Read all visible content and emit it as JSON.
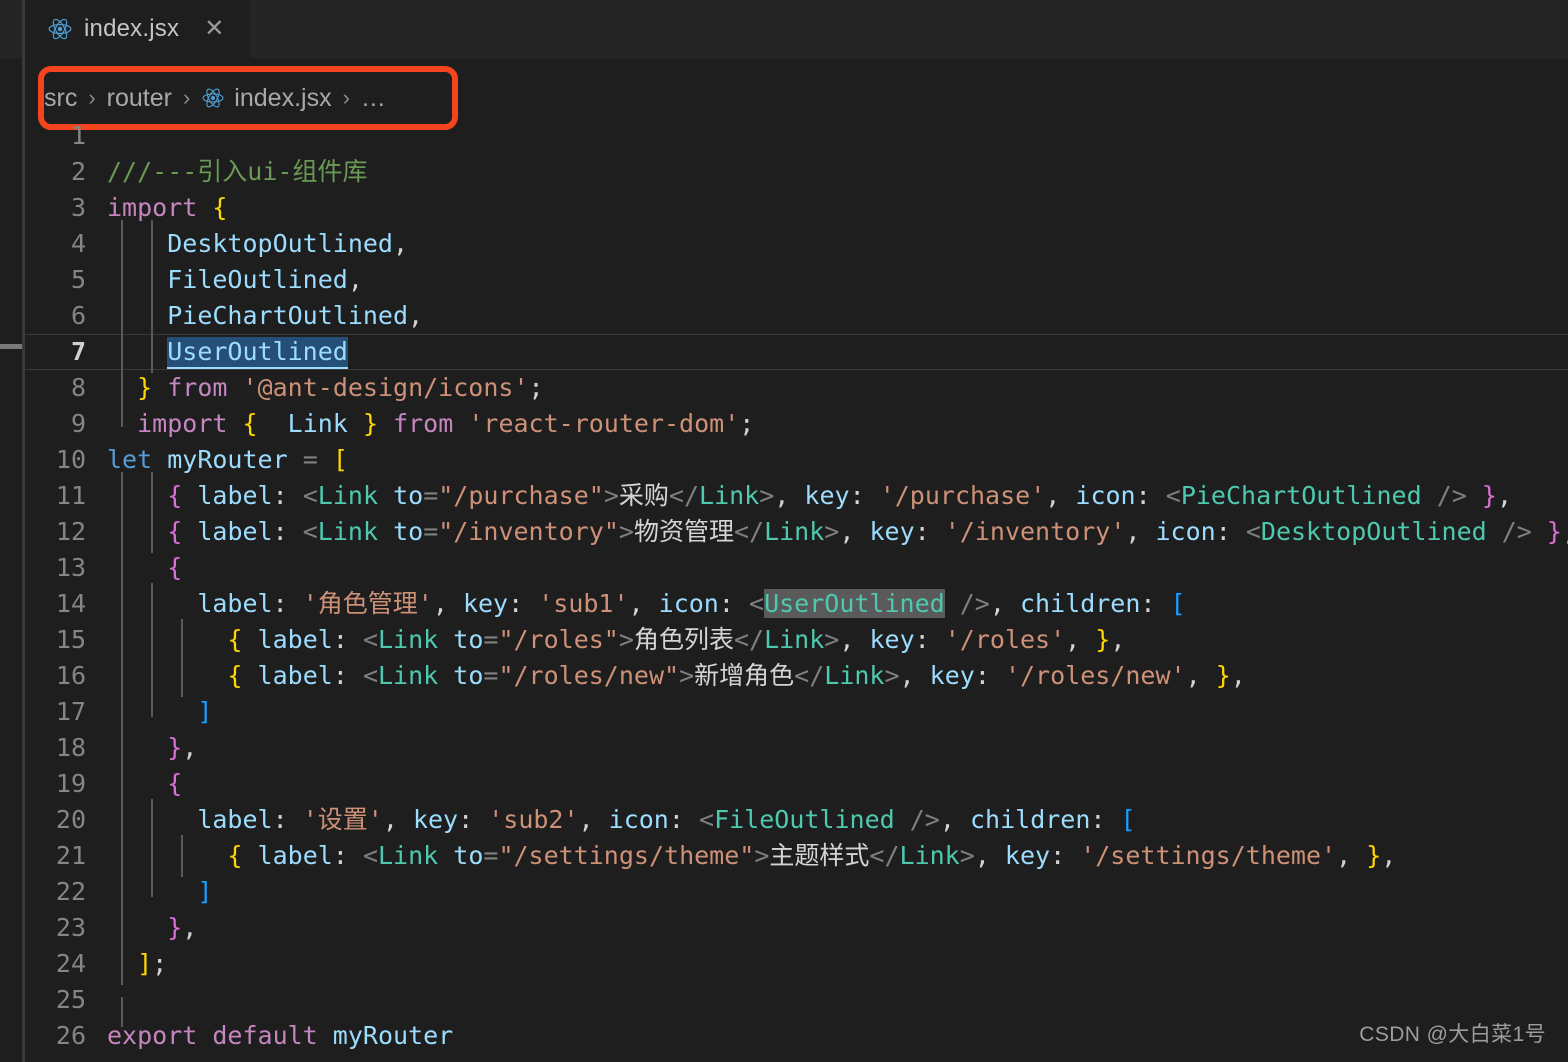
{
  "window": {
    "background": "#1e1e1e",
    "tabbar_background": "#252526"
  },
  "tab": {
    "label": "index.jsx",
    "icon": "react-icon",
    "close_icon": "✕",
    "close_label": "Close"
  },
  "breadcrumb": {
    "separator": "›",
    "items": [
      {
        "label": "src",
        "icon": null
      },
      {
        "label": "router",
        "icon": null
      },
      {
        "label": "index.jsx",
        "icon": "react-icon"
      },
      {
        "label": "…",
        "icon": null
      }
    ]
  },
  "annotation": {
    "color": "#f4441e",
    "shape": "rounded-rectangle",
    "target": "breadcrumb"
  },
  "editor": {
    "current_line": 7,
    "selection_text": "UserOutlined",
    "selection_color": "#264F78",
    "word_match_color": "#5a5a5a",
    "lines": [
      {
        "n": "1",
        "text": ""
      },
      {
        "n": "2",
        "text": "///---引入ui-组件库"
      },
      {
        "n": "3",
        "text": "import {"
      },
      {
        "n": "4",
        "text": "    DesktopOutlined,"
      },
      {
        "n": "5",
        "text": "    FileOutlined,"
      },
      {
        "n": "6",
        "text": "    PieChartOutlined,"
      },
      {
        "n": "7",
        "text": "    UserOutlined"
      },
      {
        "n": "8",
        "text": "  } from '@ant-design/icons';"
      },
      {
        "n": "9",
        "text": "  import {  Link } from 'react-router-dom';"
      },
      {
        "n": "10",
        "text": "let myRouter = ["
      },
      {
        "n": "11",
        "text": "    { label: <Link to=\"/purchase\">采购</Link>, key: '/purchase', icon: <PieChartOutlined /> },"
      },
      {
        "n": "12",
        "text": "    { label: <Link to=\"/inventory\">物资管理</Link>, key: '/inventory', icon: <DesktopOutlined /> },"
      },
      {
        "n": "13",
        "text": "    {"
      },
      {
        "n": "14",
        "text": "      label: '角色管理', key: 'sub1', icon: <UserOutlined />, children: ["
      },
      {
        "n": "15",
        "text": "        { label: <Link to=\"/roles\">角色列表</Link>, key: '/roles', },"
      },
      {
        "n": "16",
        "text": "        { label: <Link to=\"/roles/new\">新增角色</Link>, key: '/roles/new', },"
      },
      {
        "n": "17",
        "text": "      ]"
      },
      {
        "n": "18",
        "text": "    },"
      },
      {
        "n": "19",
        "text": "    {"
      },
      {
        "n": "20",
        "text": "      label: '设置', key: 'sub2', icon: <FileOutlined />, children: ["
      },
      {
        "n": "21",
        "text": "        { label: <Link to=\"/settings/theme\">主题样式</Link>, key: '/settings/theme', },"
      },
      {
        "n": "22",
        "text": "      ]"
      },
      {
        "n": "23",
        "text": "    },"
      },
      {
        "n": "24",
        "text": "  ];"
      },
      {
        "n": "25",
        "text": ""
      },
      {
        "n": "26",
        "text": "export default myRouter"
      }
    ]
  },
  "watermark": {
    "text": "CSDN @大白菜1号"
  }
}
